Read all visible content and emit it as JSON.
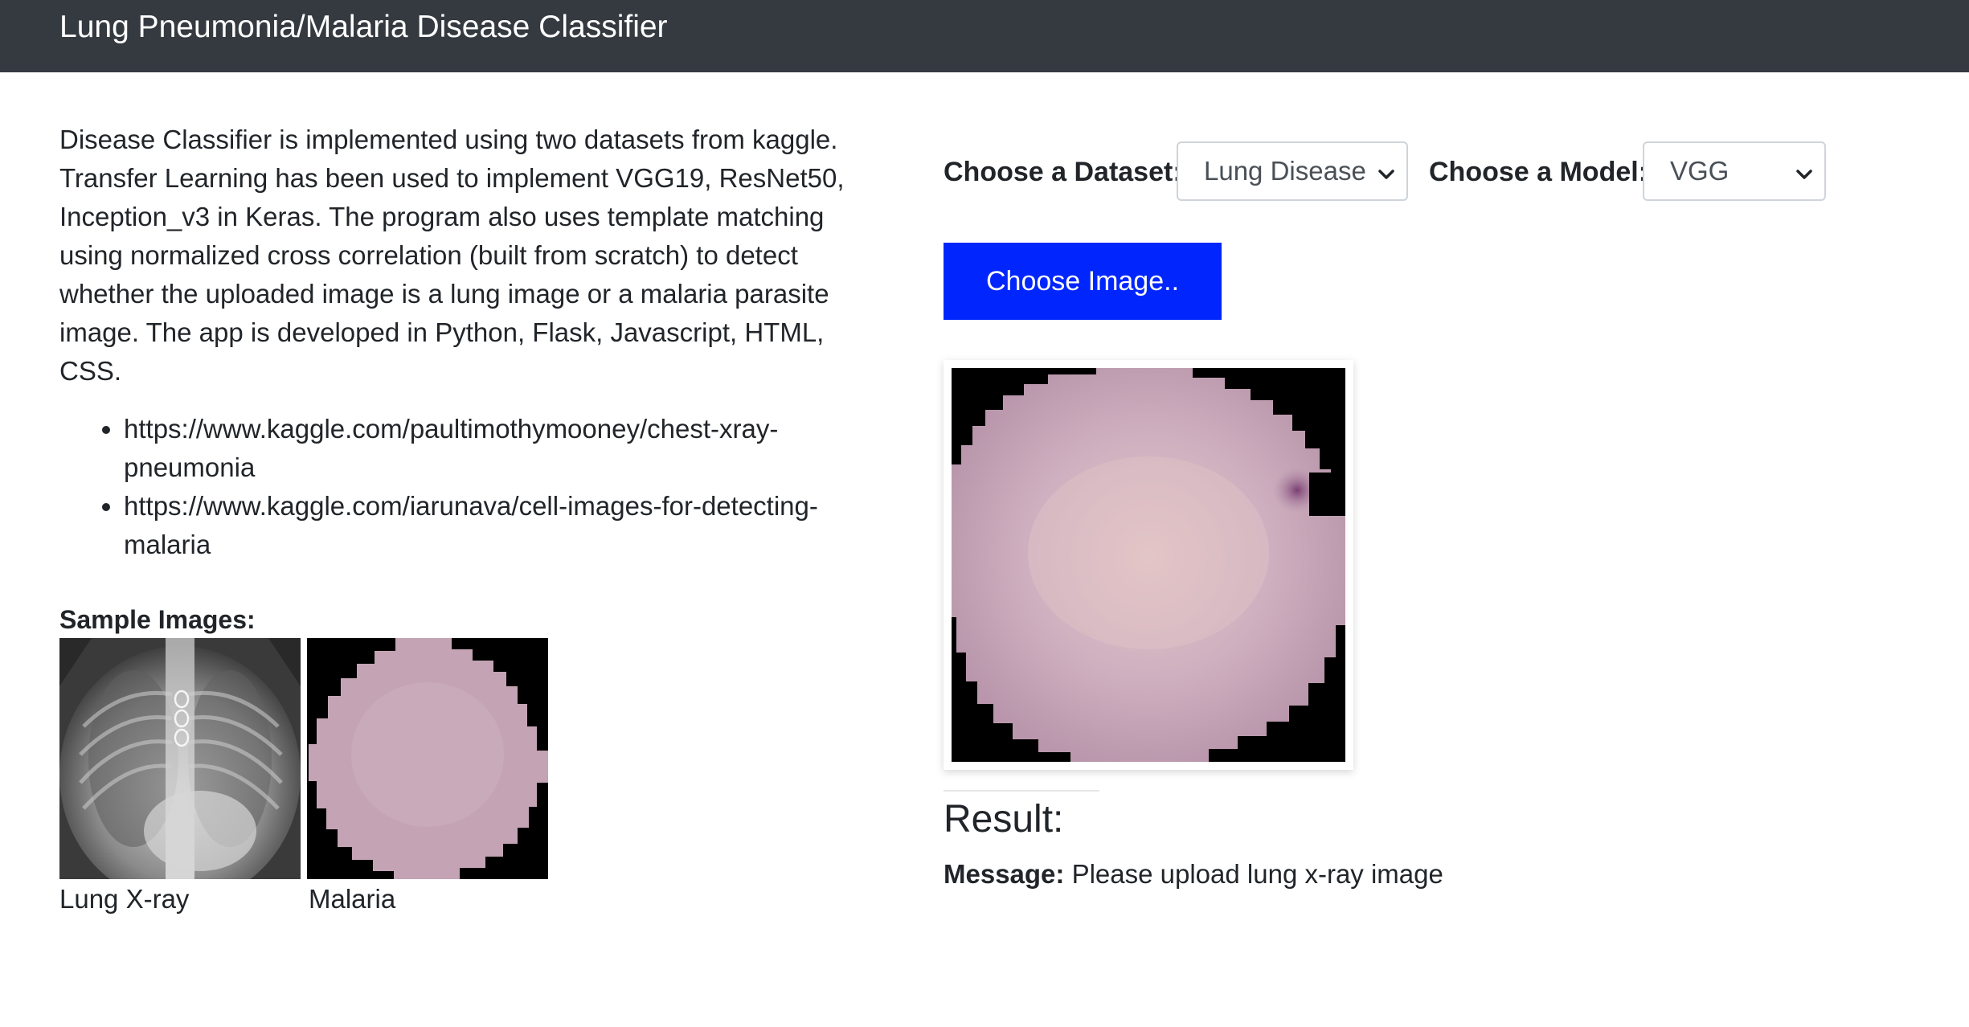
{
  "navbar": {
    "title": "Lung Pneumonia/Malaria Disease Classifier"
  },
  "intro": {
    "description": "Disease Classifier is implemented using two datasets from kaggle. Transfer Learning has been used to implement VGG19, ResNet50, Inception_v3 in Keras. The program also uses template matching using normalized cross correlation (built from scratch) to detect whether the uploaded image is a lung image or a malaria parasite image. The app is developed in Python, Flask, Javascript, HTML, CSS.",
    "links": [
      "https://www.kaggle.com/paultimothymooney/chest-xray-pneumonia",
      "https://www.kaggle.com/iarunava/cell-images-for-detecting-malaria"
    ]
  },
  "samples": {
    "title": "Sample Images:",
    "items": [
      {
        "caption": "Lung X-ray"
      },
      {
        "caption": "Malaria"
      }
    ]
  },
  "controls": {
    "dataset_label": "Choose a Dataset:",
    "dataset_selected": "Lung Disease",
    "model_label": "Choose a Model:",
    "model_selected": "VGG",
    "choose_image_label": "Choose Image.."
  },
  "result": {
    "title": "Result:",
    "message_label": "Message:",
    "message_text": "Please upload lung x-ray image"
  },
  "colors": {
    "navbar_bg": "#343a40",
    "button_bg": "#0026fd",
    "cell_color": "#c7a7b8"
  },
  "icons": [
    "chevron-down-icon"
  ]
}
